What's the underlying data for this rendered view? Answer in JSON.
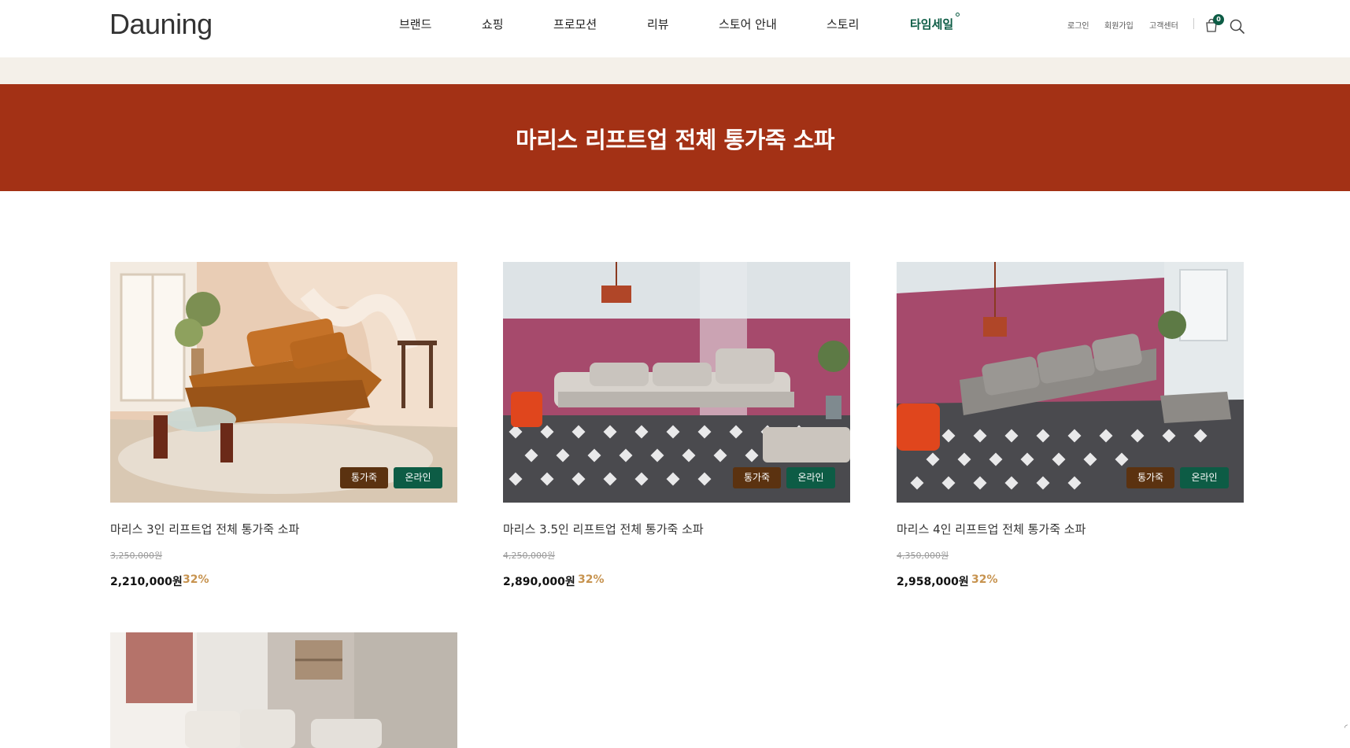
{
  "header": {
    "logo": "Dauning",
    "nav": [
      "브랜드",
      "쇼핑",
      "프로모션",
      "리뷰",
      "스토어 안내",
      "스토리",
      "타임세일"
    ],
    "util": [
      "로그인",
      "회원가입",
      "고객센터"
    ],
    "cart_count": "0"
  },
  "hero": {
    "title": "마리스 리프트업 전체 통가죽 소파"
  },
  "products": [
    {
      "name": "마리스 3인 리프트업 전체 통가죽 소파",
      "orig_price": "3,250,000원",
      "price": "2,210,000원",
      "discount": "32%",
      "tags": [
        "통가죽",
        "온라인"
      ]
    },
    {
      "name": "마리스 3.5인 리프트업 전체 통가죽 소파",
      "orig_price": "4,250,000원",
      "price": "2,890,000원",
      "discount": "32%",
      "tags": [
        "통가죽",
        "온라인"
      ]
    },
    {
      "name": "마리스 4인 리프트업 전체 통가죽 소파",
      "orig_price": "4,350,000원",
      "price": "2,958,000원",
      "discount": "32%",
      "tags": [
        "통가죽",
        "온라인"
      ]
    }
  ],
  "colors": {
    "hero_bg": "#a33115",
    "beige_band": "#f4f0e9",
    "accent_green": "#0d5c45",
    "tag_brown": "#5b3210",
    "discount": "#c7934f"
  },
  "icons": [
    "cart-icon",
    "search-icon"
  ]
}
